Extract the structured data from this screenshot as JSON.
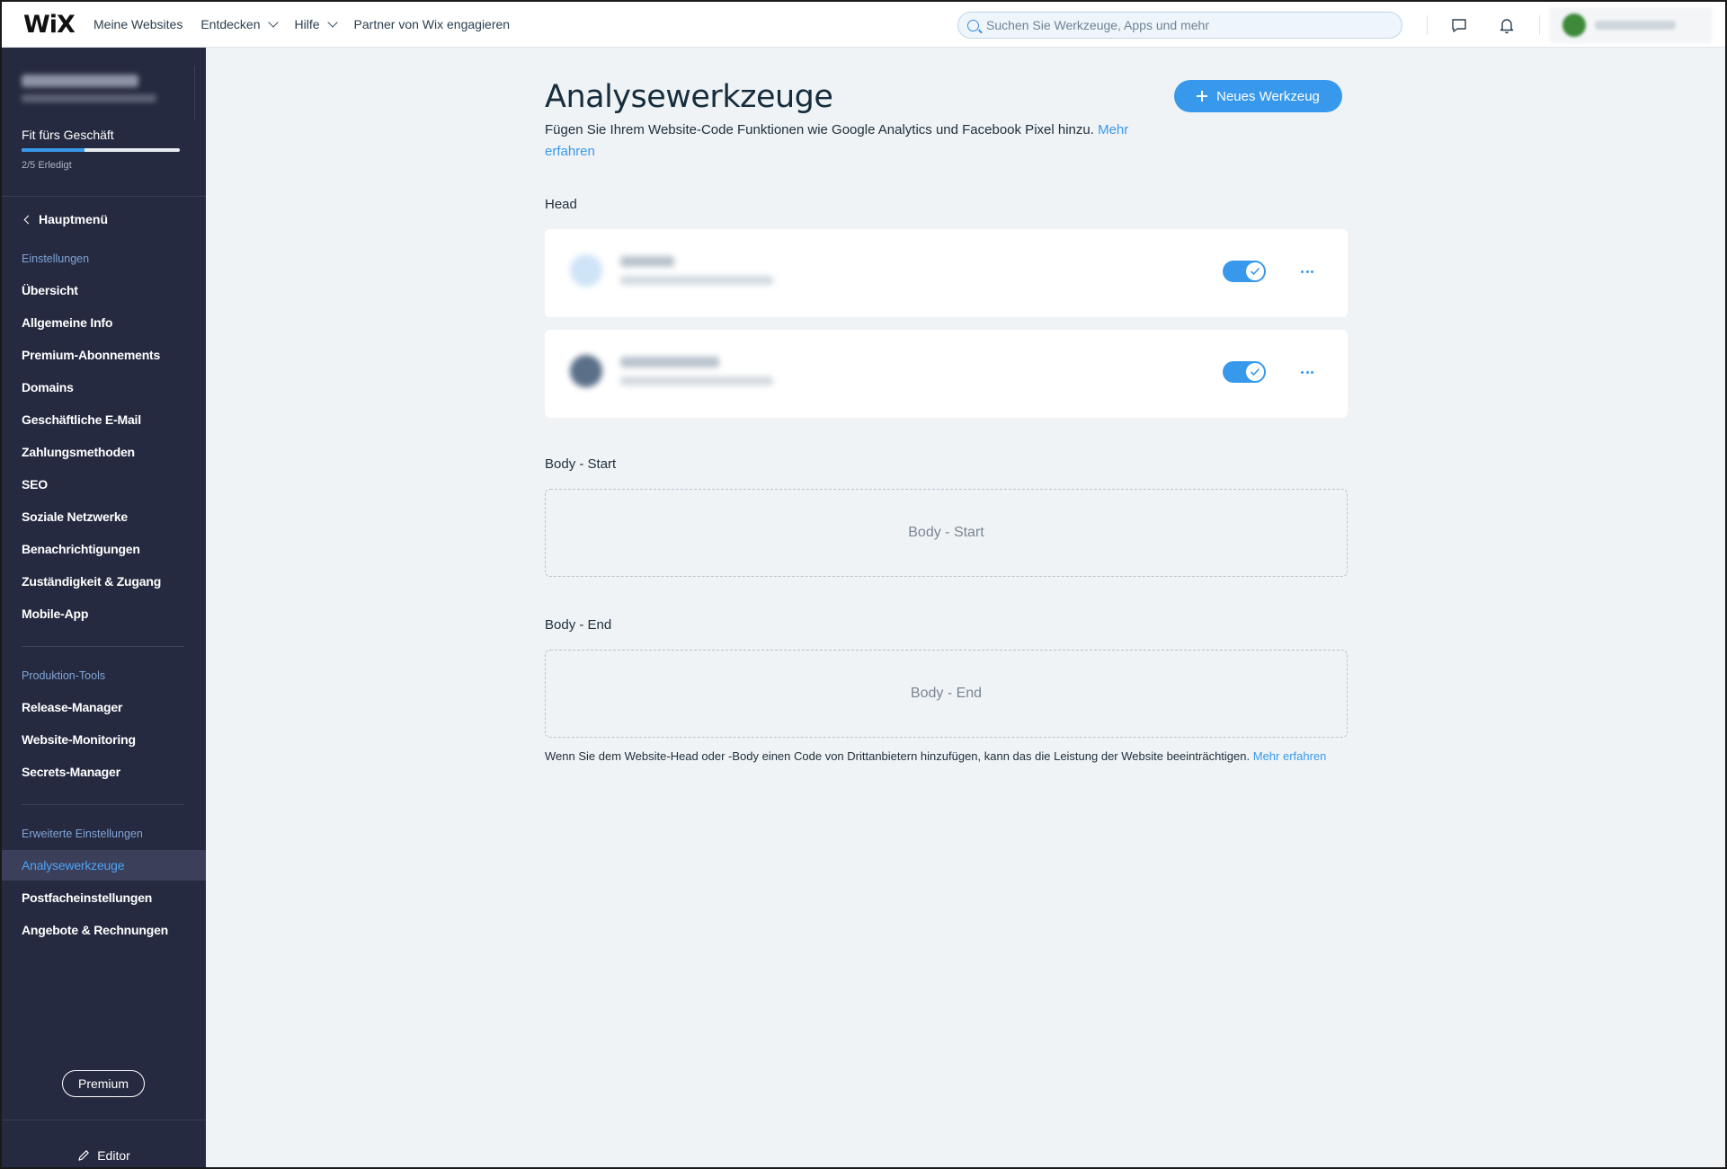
{
  "topbar": {
    "logo": "WiX",
    "nav": [
      {
        "label": "Meine Websites",
        "dropdown": false
      },
      {
        "label": "Entdecken",
        "dropdown": true
      },
      {
        "label": "Hilfe",
        "dropdown": true
      },
      {
        "label": "Partner von Wix engagieren",
        "dropdown": false
      }
    ],
    "search_placeholder": "Suchen Sie Werkzeuge, Apps und mehr"
  },
  "sidebar": {
    "setup_label": "Fit fürs Geschäft",
    "progress_fraction": 0.4,
    "progress_text": "2/5 Erledigt",
    "back_label": "Hauptmenü",
    "section_settings": "Einstellungen",
    "settings_items": [
      "Übersicht",
      "Allgemeine Info",
      "Premium-Abonnements",
      "Domains",
      "Geschäftliche E-Mail",
      "Zahlungsmethoden",
      "SEO",
      "Soziale Netzwerke",
      "Benachrichtigungen",
      "Zuständigkeit & Zugang",
      "Mobile-App"
    ],
    "section_production": "Produktion-Tools",
    "production_items": [
      "Release-Manager",
      "Website-Monitoring",
      "Secrets-Manager"
    ],
    "section_advanced": "Erweiterte Einstellungen",
    "advanced_items": [
      "Analysewerkzeuge",
      "Postfacheinstellungen",
      "Angebote & Rechnungen"
    ],
    "active_item": "Analysewerkzeuge",
    "premium_label": "Premium",
    "editor_label": "Editor"
  },
  "main": {
    "title": "Analysewerkzeuge",
    "description": "Fügen Sie Ihrem Website-Code Funktionen wie Google Analytics und Facebook Pixel hinzu.",
    "learn_more": "Mehr erfahren",
    "new_tool_label": "Neues Werkzeug",
    "head_label": "Head",
    "head_tools": [
      {
        "enabled": true,
        "icon_color": "#cfe4f7"
      },
      {
        "enabled": true,
        "icon_color": "#5a6f88"
      }
    ],
    "body_start_label": "Body - Start",
    "body_start_placeholder": "Body - Start",
    "body_end_label": "Body - End",
    "body_end_placeholder": "Body - End",
    "footnote": "Wenn Sie dem Website-Head oder -Body einen Code von Drittanbietern hinzufügen, kann das die Leistung der Website beeinträchtigen.",
    "footnote_link": "Mehr erfahren"
  },
  "colors": {
    "accent": "#3899ec",
    "sidebar_bg": "#262a40",
    "page_bg": "#eff3f6"
  }
}
